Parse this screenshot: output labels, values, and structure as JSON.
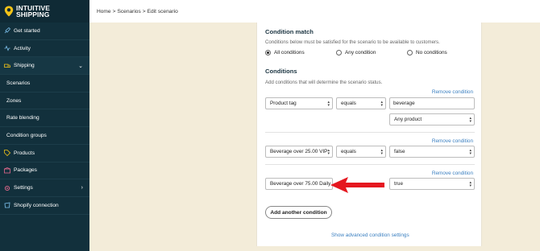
{
  "brand": {
    "line1": "INTUITIVE",
    "line2": "SHIPPING"
  },
  "breadcrumb": {
    "home": "Home",
    "sep1": ">",
    "scenarios": "Scenarios",
    "sep2": ">",
    "current": "Edit scenario"
  },
  "sidebar": {
    "items": [
      {
        "label": "Get started",
        "icon": "rocket-icon"
      },
      {
        "label": "Activity",
        "icon": "activity-icon"
      },
      {
        "label": "Shipping",
        "icon": "truck-icon"
      },
      {
        "label": "Scenarios"
      },
      {
        "label": "Zones"
      },
      {
        "label": "Rate blending"
      },
      {
        "label": "Condition groups"
      },
      {
        "label": "Products",
        "icon": "tag-icon"
      },
      {
        "label": "Packages",
        "icon": "package-icon"
      },
      {
        "label": "Settings",
        "icon": "gear-icon"
      },
      {
        "label": "Shopify connection",
        "icon": "shopify-icon"
      }
    ]
  },
  "condition_match": {
    "title": "Condition match",
    "description": "Conditions below must be satisfied for the scenario to be available to customers.",
    "options": [
      "All conditions",
      "Any condition",
      "No conditions"
    ],
    "selected": "All conditions"
  },
  "conditions": {
    "title": "Conditions",
    "description": "Add conditions that will determine the scenario status.",
    "remove_label": "Remove condition",
    "rows": [
      {
        "field": "Product tag",
        "operator": "equals",
        "value": "beverage",
        "extra": "Any product"
      },
      {
        "field": "Beverage over 25.00 VIP",
        "operator": "equals",
        "value": "false"
      },
      {
        "field": "Beverage over 75.00 Daily",
        "value": "true"
      }
    ],
    "add_label": "Add another condition",
    "advanced_label": "Show advanced condition settings"
  },
  "colors": {
    "sidebar": "#12303c",
    "accent_link": "#3a7fc0",
    "arrow": "#e5171f",
    "background": "#f3ecd9"
  }
}
